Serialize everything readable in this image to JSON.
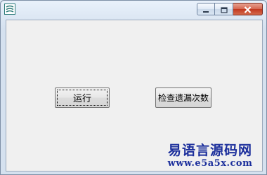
{
  "window": {
    "caption_buttons": [
      "minimize",
      "maximize",
      "close"
    ]
  },
  "buttons": {
    "run_label": "运行",
    "check_label": "检查遗漏次数"
  },
  "watermark": {
    "title": "易语言源码网",
    "url": "www.e5a5x.com"
  },
  "colors": {
    "watermark": "#1c2f9c",
    "close_button": "#c2391f",
    "client_bg": "#f0f0f0"
  },
  "icons": {
    "app": "app-logo-icon",
    "minimize": "minimize-icon",
    "maximize": "maximize-icon",
    "close": "close-icon"
  }
}
